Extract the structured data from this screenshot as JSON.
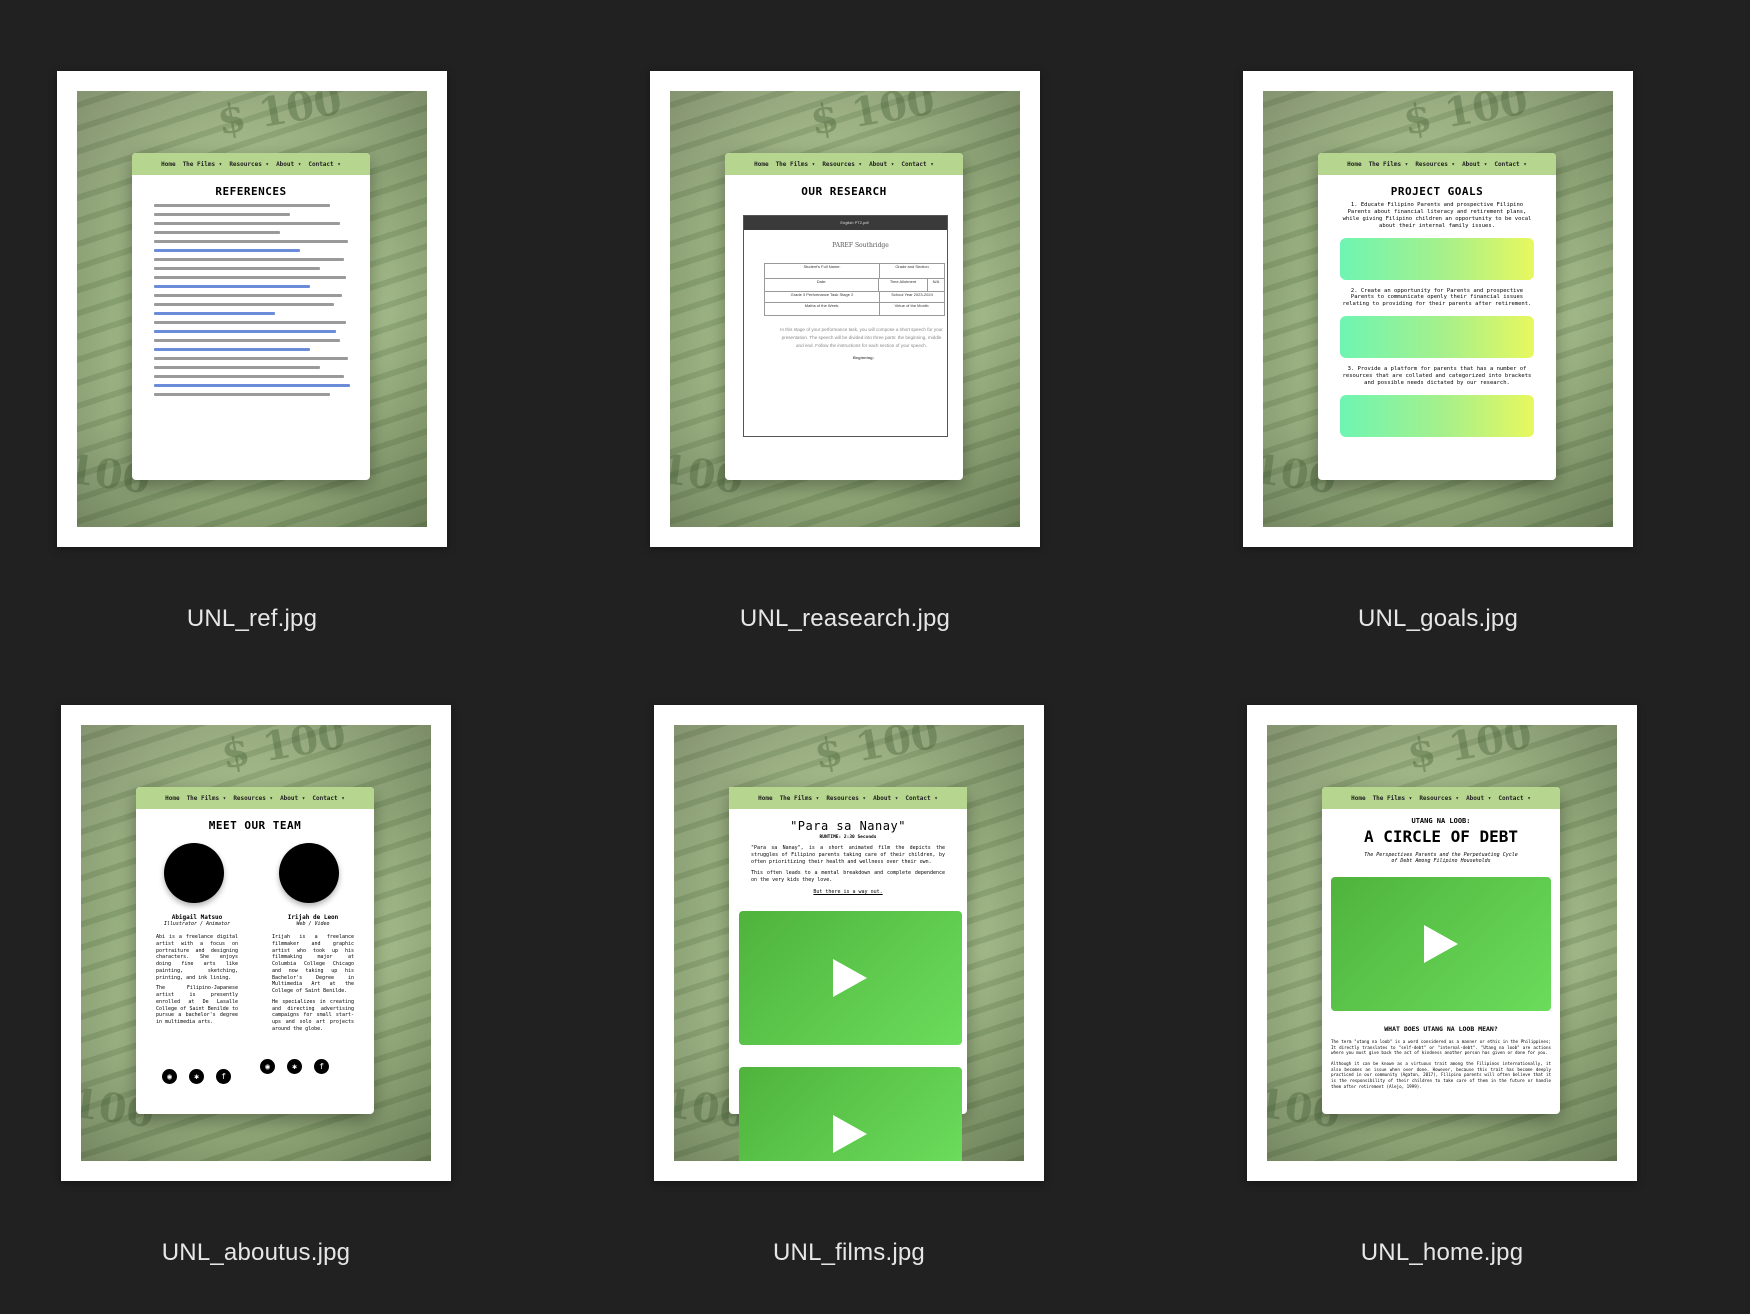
{
  "nav": [
    "Home",
    "The Films ▾",
    "Resources ▾",
    "About ▾",
    "Contact ▾"
  ],
  "files": [
    {
      "name": "UNL_ref.jpg",
      "title": "REFERENCES"
    },
    {
      "name": "UNL_reasearch.jpg",
      "title": "OUR RESEARCH",
      "pdf_name": "English PT2.pdf",
      "pdf_brand": "PAREF Southridge",
      "pdf_rows": [
        "Student's Full Name:",
        "Grade and Section",
        "Date:",
        "Time Allotment",
        "N/A",
        "Grade 3 Performance Task Stage 2",
        "School Year 2023-2024",
        "Maths of the Week:",
        "Virtue of the Month:"
      ],
      "pdf_body": "In this stage of your performance task, you will compose a short speech for your presentation. The speech will be divided into three parts: the beginning, middle and end. Follow the instructions for each section of your speech.",
      "pdf_begin": "Beginning:"
    },
    {
      "name": "UNL_goals.jpg",
      "title": "PROJECT GOALS",
      "goals": [
        "1. Educate Filipino Parents and prospective Filipino Parents about financial literacy and retirement plans, while giving Filipino children an opportunity to be vocal about their internal family issues.",
        "2. Create an opportunity for Parents and prospective Parents to communicate openly their financial issues relating to providing for their parents after retirement.",
        "3. Provide a platform for parents that has a number of resources that are collated and categorized into brackets and possible needs dictated by our research."
      ]
    },
    {
      "name": "UNL_aboutus.jpg",
      "title": "MEET OUR TEAM",
      "members": [
        {
          "name": "Abigail Matsuo",
          "role": "Illustrator / Animator",
          "bio": "Abi is a freelance digital artist with a focus on portraiture and designing characters. She enjoys doing fine arts like painting, sketching, printing, and ink lining.",
          "bio2": "The Filipino-Japanese artist is presently enrolled at De Lasalle College of Saint Benilde to pursue a bachelor's degree in multimedia arts."
        },
        {
          "name": "Irijah de Leon",
          "role": "Web / Video",
          "bio": "Irijah is a freelance filmmaker and graphic artist who took up his filmmaking major at Columbia College Chicago and now taking up his Bachelor's Degree in Multimedia Art at the College of Saint Benilde.",
          "bio2": "He specializes in creating and directing advertising campaigns for small start-ups and solo art projects around the globe."
        }
      ]
    },
    {
      "name": "UNL_films.jpg",
      "title": "\"Para sa Nanay\"",
      "runtime": "RUNTIME: 2:30 Seconds",
      "p1": "\"Para sa Nanay\", is a short animated film the depicts the struggles of Filipino parents taking care of their children, by often prioritizing their health and wellness over their own.",
      "p2": "This often leads to a mental breakdown and complete dependence on the very kids they love.",
      "p3": "But there is a way out."
    },
    {
      "name": "UNL_home.jpg",
      "kicker": "UTANG NA LOOB:",
      "title": "A CIRCLE OF DEBT",
      "subtitle": "The Perspectives Parents and the Perpetuating Cycle of Debt Among Filipino Households",
      "q": "WHAT DOES UTANG NA LOOB MEAN?",
      "p1": "The term \"utang na loob\" is a word considered as a manner or ethic in the Philippines; It directly translates to \"self-debt\" or \"internal-debt\". \"Utang na loob\" are actions where you must give back the act of kindness another person has given or done for you.",
      "p2": "Although it can be known as a virtuous trait among the Filipinos internationally, it also becomes an issue when over done. However, because this trait has become deeply practiced in our community (Agaton, 2017), Filipino parents will often believe that it is the responsibility of their children to take care of them in the future or handle them after retirement (Alejo, 1999)."
    }
  ]
}
